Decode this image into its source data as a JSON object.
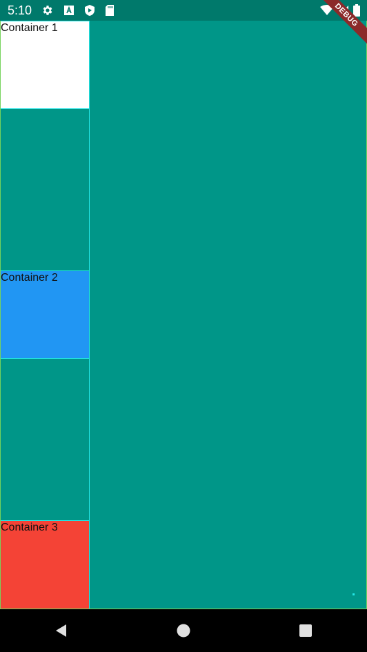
{
  "status_bar": {
    "time": "5:10",
    "left_icons": [
      "settings-icon",
      "a-box-icon",
      "shield-play-icon",
      "sd-card-icon"
    ],
    "right_icons": [
      "wifi-icon",
      "signal-icon",
      "battery-icon"
    ],
    "color": "#00796b"
  },
  "debug_banner": {
    "label": "DEBUG",
    "color": "#8b2a2a"
  },
  "containers": [
    {
      "label": "Container 1",
      "color": "#ffffff"
    },
    {
      "label": "Container 2",
      "color": "#2196f3"
    },
    {
      "label": "Container 3",
      "color": "#f44336"
    }
  ],
  "colors": {
    "background": "#009688",
    "border_outer": "#76d35c",
    "border_inner": "#25e6e6"
  },
  "nav_bar": {
    "buttons": [
      "back-icon",
      "home-icon",
      "recents-icon"
    ]
  }
}
